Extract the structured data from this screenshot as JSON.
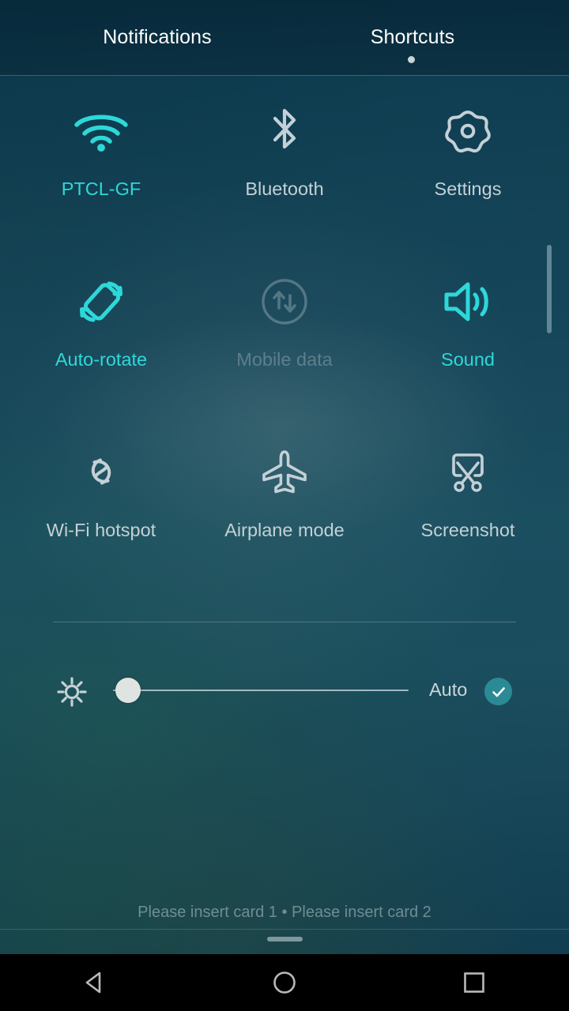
{
  "header": {
    "tabs": [
      {
        "label": "Notifications",
        "active": false
      },
      {
        "label": "Shortcuts",
        "active": true
      }
    ]
  },
  "shortcuts": {
    "tiles": [
      {
        "label": "PTCL-GF",
        "icon": "wifi-icon",
        "state": "on"
      },
      {
        "label": "Bluetooth",
        "icon": "bluetooth-icon",
        "state": "off"
      },
      {
        "label": "Settings",
        "icon": "gear-icon",
        "state": "off"
      },
      {
        "label": "Auto-rotate",
        "icon": "auto-rotate-icon",
        "state": "on"
      },
      {
        "label": "Mobile data",
        "icon": "mobile-data-icon",
        "state": "disabled"
      },
      {
        "label": "Sound",
        "icon": "sound-icon",
        "state": "on"
      },
      {
        "label": "Wi-Fi hotspot",
        "icon": "hotspot-icon",
        "state": "off"
      },
      {
        "label": "Airplane mode",
        "icon": "airplane-icon",
        "state": "off"
      },
      {
        "label": "Screenshot",
        "icon": "screenshot-icon",
        "state": "off"
      }
    ]
  },
  "brightness": {
    "icon": "brightness-sun-icon",
    "value_percent": 3,
    "auto_label": "Auto",
    "auto_enabled": true
  },
  "footer": {
    "status_text": "Please insert card 1 • Please insert card 2"
  },
  "navbar": {
    "back_label": "Back",
    "home_label": "Home",
    "recents_label": "Recents"
  },
  "colors": {
    "accent_on": "#2fd8d8",
    "label_off": "#c3d1d6",
    "auto_check_bg": "#2a8b97",
    "background_top": "#0b3447",
    "background_mid": "#1b5060"
  }
}
